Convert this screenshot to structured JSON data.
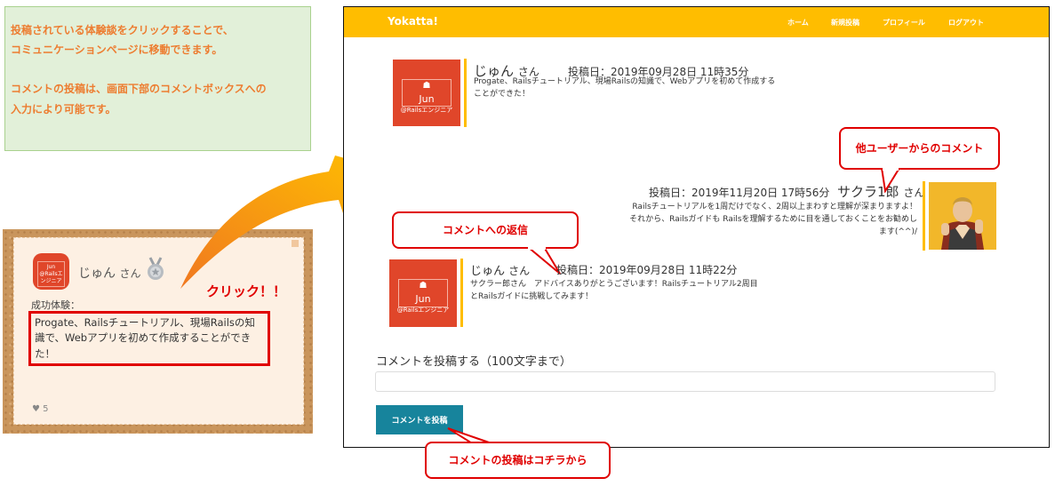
{
  "info": {
    "line1": "投稿されている体験談をクリックすることで、",
    "line2": "コミュニケーションページに移動できます。",
    "line3": "コメントの投稿は、画面下部のコメントボックスへの",
    "line4": "入力により可能です。"
  },
  "card": {
    "avatar_name": "Jun",
    "avatar_sub": "@Railsエンジニア",
    "user_name": "じゅん",
    "user_suffix": "さん",
    "label": "成功体験：",
    "text": "Progate、Railsチュートリアル、現場Railsの知識で、Webアプリを初めて作成することができた！",
    "likes": "5",
    "like_icon": "heart-icon",
    "medal_icon": "medal-icon"
  },
  "click_label": "クリック！！",
  "app": {
    "brand": "Yokatta!",
    "nav": [
      "ホーム",
      "新規投稿",
      "プロフィール",
      "ログアウト"
    ],
    "accent_color": "#ffbd00",
    "button_color": "#17849c"
  },
  "post": {
    "avatar_name": "Jun",
    "avatar_sub": "@Railsエンジニア",
    "user_name": "じゅん",
    "user_suffix": "さん",
    "date": "投稿日：2019年09月28日 11時35分",
    "body": "Progate、Railsチュートリアル、現場Railsの知識で、Webアプリを初めて作成することができた！"
  },
  "other_comment": {
    "date": "投稿日：2019年11月20日 17時56分",
    "user_name": "サクラ1郎",
    "user_suffix": "さん",
    "body": "Railsチュートリアルを1周だけでなく、2周以上まわすと理解が深まりますよ！　それから、Railsガイドも Railsを理解するために目を通しておくことをお勧めします(^^)/"
  },
  "reply": {
    "avatar_name": "Jun",
    "avatar_sub": "@Railsエンジニア",
    "user_name": "じゅん",
    "user_suffix": "さん",
    "date": "投稿日：2019年09月28日 11時22分",
    "body": "サクラー郎さん　アドバイスありがとうございます！Railsチュートリアル2周目とRailsガイドに挑戦してみます！"
  },
  "callouts": {
    "other": "他ユーザーからのコメント",
    "reply": "コメントへの返信",
    "submit": "コメントの投稿はコチラから"
  },
  "comment_form": {
    "label": "コメントを投稿する（100文字まで）",
    "placeholder": "",
    "value": "",
    "button": "コメントを投稿"
  }
}
